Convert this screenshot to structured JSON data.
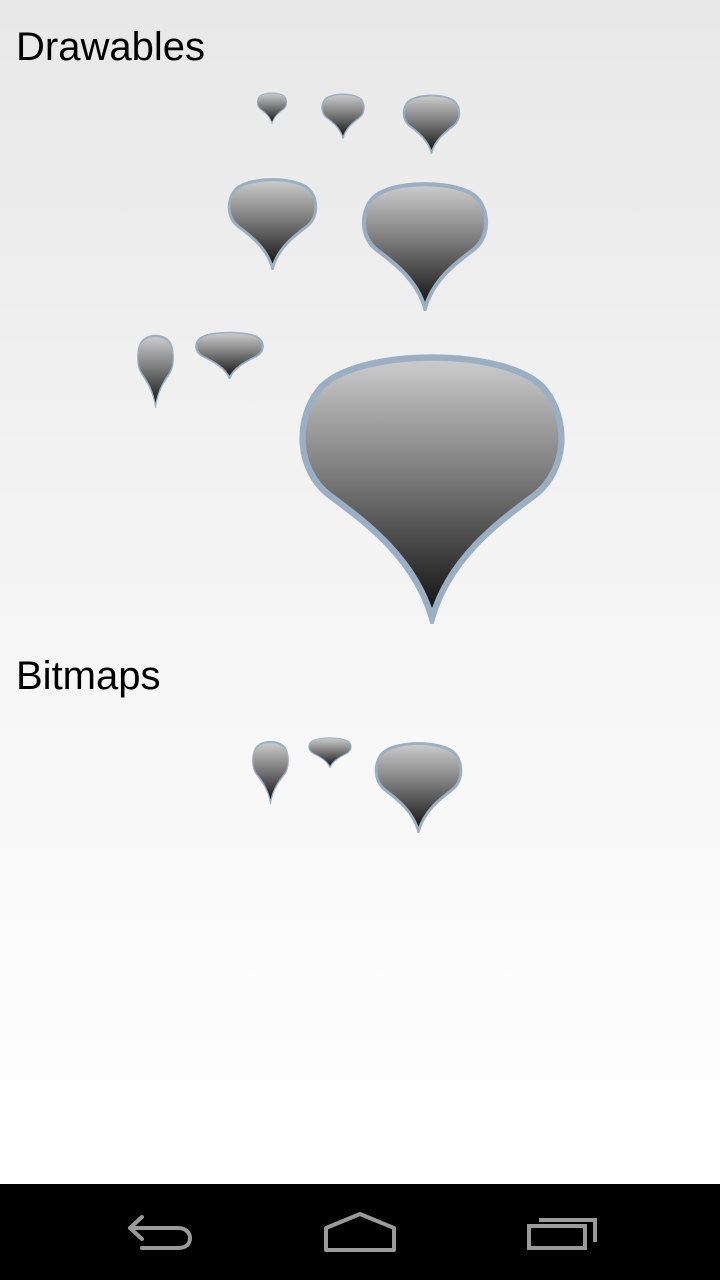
{
  "sections": {
    "drawables_title": "Drawables",
    "bitmaps_title": "Bitmaps"
  },
  "markers": {
    "fill_top_color": "#c8c8c8",
    "fill_bottom_color": "#111111",
    "outline_color": "#9aaec4"
  },
  "navbar": {
    "back_icon": "back-arrow-icon",
    "home_icon": "home-icon",
    "recent_icon": "recent-apps-icon",
    "icon_color": "#9a9a9a"
  }
}
